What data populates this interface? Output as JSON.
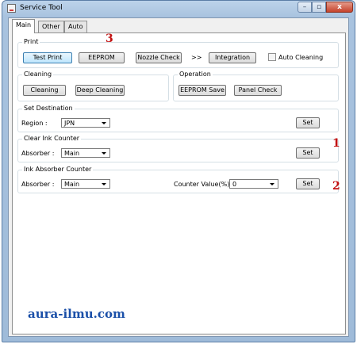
{
  "window": {
    "title": "Service Tool",
    "controls": {
      "minimize": "–",
      "maximize": "▫",
      "close": "x"
    }
  },
  "tabs": [
    {
      "label": "Main",
      "active": true
    },
    {
      "label": "Other",
      "active": false
    },
    {
      "label": "Auto",
      "active": false
    }
  ],
  "print": {
    "group_label": "Print",
    "test_print": "Test Print",
    "eeprom": "EEPROM",
    "nozzle_check": "Nozzle Check",
    "arrow": ">>",
    "integration": "Integration",
    "auto_cleaning_label": "Auto Cleaning",
    "auto_cleaning_checked": false
  },
  "cleaning": {
    "group_label": "Cleaning",
    "cleaning": "Cleaning",
    "deep_cleaning": "Deep Cleaning"
  },
  "operation": {
    "group_label": "Operation",
    "eeprom_save": "EEPROM Save",
    "panel_check": "Panel Check"
  },
  "set_destination": {
    "group_label": "Set Destination",
    "region_label": "Region :",
    "region_value": "JPN",
    "set": "Set"
  },
  "clear_ink_counter": {
    "group_label": "Clear Ink Counter",
    "absorber_label": "Absorber :",
    "absorber_value": "Main",
    "set": "Set"
  },
  "ink_absorber_counter": {
    "group_label": "Ink Absorber Counter",
    "absorber_label": "Absorber :",
    "absorber_value": "Main",
    "counter_label": "Counter Value(%) :",
    "counter_value": "0",
    "set": "Set"
  },
  "annotations": {
    "one": "1",
    "two": "2",
    "three": "3"
  },
  "watermark": "aura-ilmu.com",
  "colors": {
    "annotation": "#c21010",
    "watermark": "#1a4fa8",
    "titlebar": "#a9c3df"
  }
}
